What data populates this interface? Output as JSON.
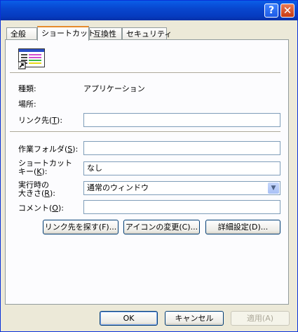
{
  "titlebar": {
    "help_glyph": "?",
    "close_glyph": "✕"
  },
  "tabs": [
    {
      "label": "全般"
    },
    {
      "label": "ショートカット"
    },
    {
      "label": "互換性"
    },
    {
      "label": "セキュリティ"
    }
  ],
  "fields": {
    "type_label": "種類:",
    "type_value": "アプリケーション",
    "location_label": "場所:",
    "target": {
      "label": "リンク先(",
      "key": "T",
      "suffix": "):",
      "value": ""
    },
    "workdir": {
      "label": "作業フォルダ(",
      "key": "S",
      "suffix": "):",
      "value": ""
    },
    "shortcut": {
      "label1": "ショートカット",
      "label2": "キー(",
      "key": "K",
      "suffix": "):",
      "value": "なし"
    },
    "run": {
      "label1": "実行時の",
      "label2": "大きさ(",
      "key": "R",
      "suffix": "):",
      "value": "通常のウィンドウ"
    },
    "comment": {
      "label": "コメント(",
      "key": "O",
      "suffix": "):",
      "value": ""
    }
  },
  "panel_buttons": {
    "find_target": "リンク先を探す(F)...",
    "change_icon": "アイコンの変更(C)...",
    "advanced": "詳細設定(D)..."
  },
  "footer": {
    "ok": "OK",
    "cancel": "キャンセル",
    "apply": "適用(A)"
  }
}
